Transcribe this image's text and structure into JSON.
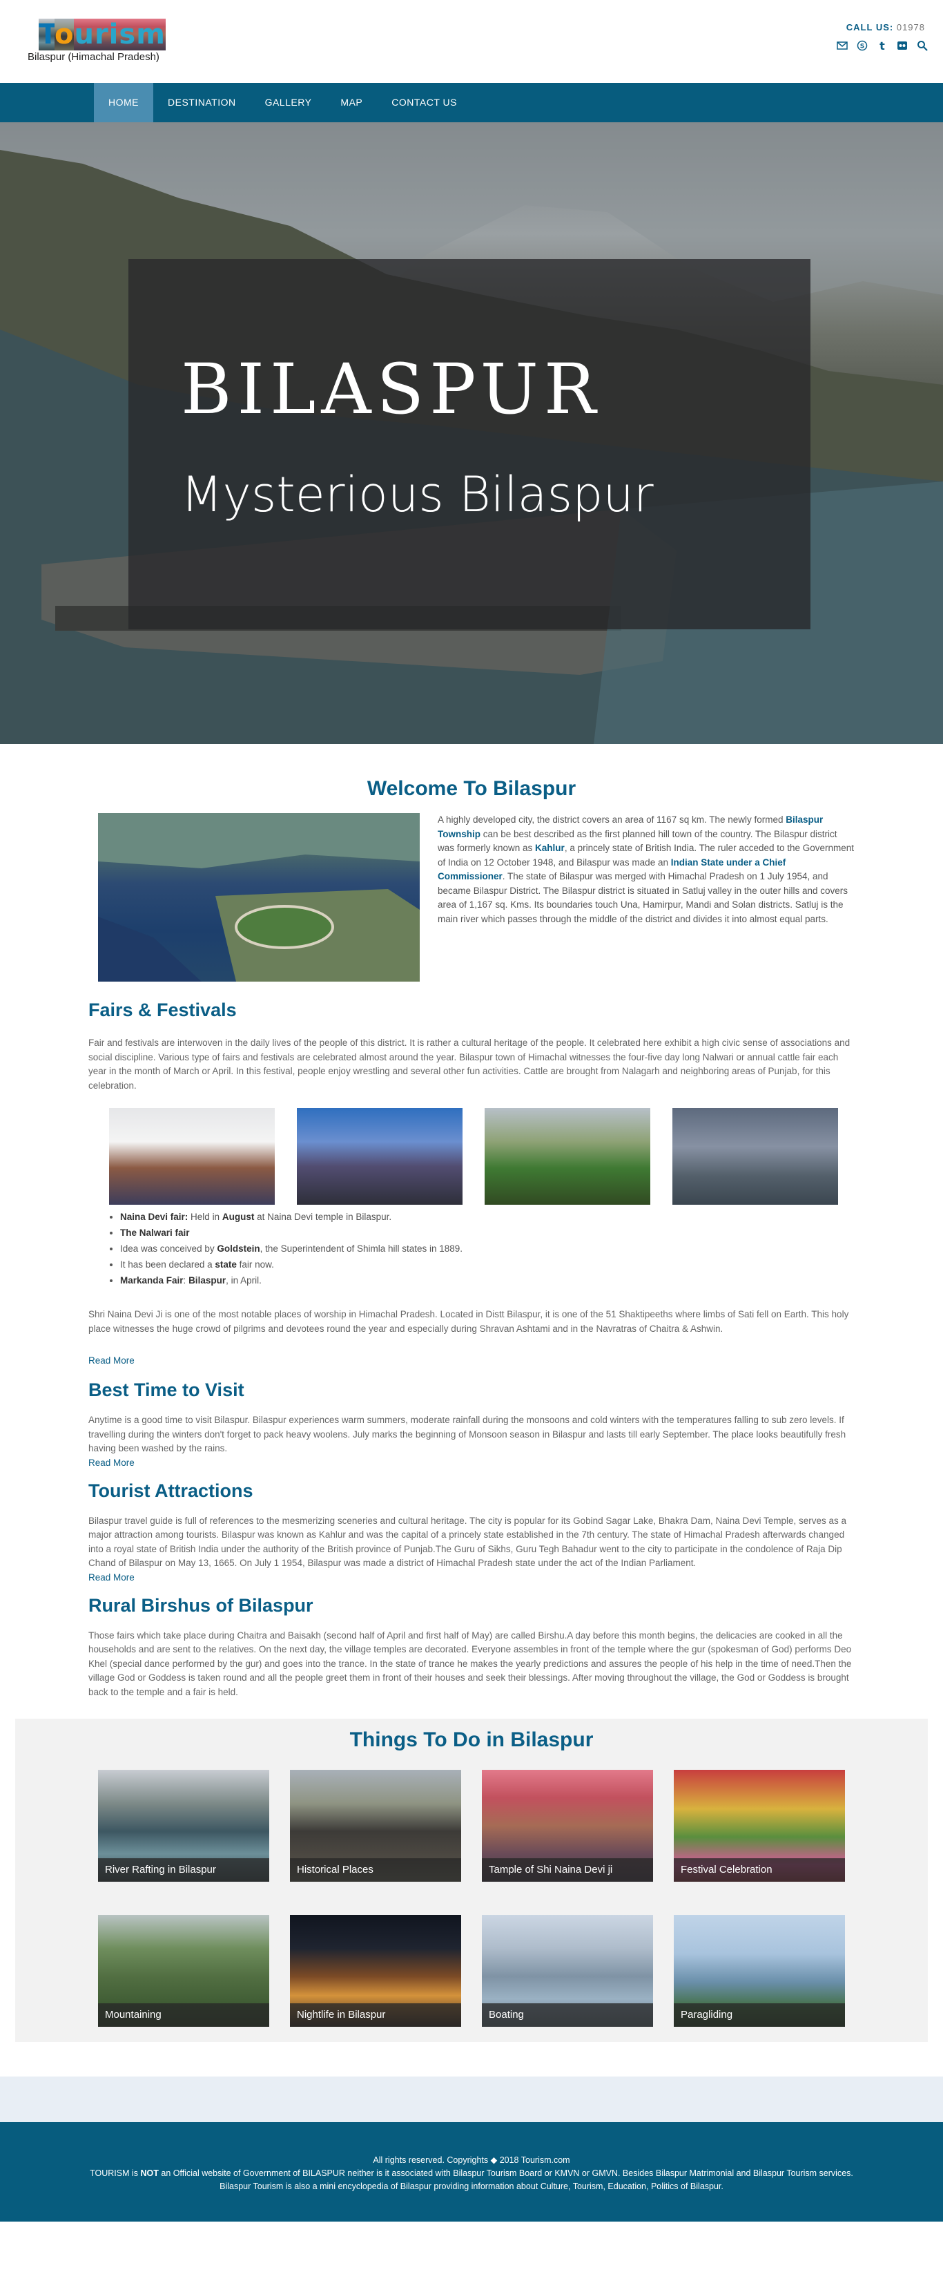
{
  "header": {
    "logo_text": "Tourism",
    "subtitle": "Bilaspur (Himachal Pradesh)",
    "call_label": "CALL US:",
    "call_number": "01978",
    "social_icons": [
      "mail-icon",
      "skype-icon",
      "tumblr-icon",
      "flickr-icon",
      "search-icon"
    ]
  },
  "nav": {
    "items": [
      {
        "label": "HOME",
        "active": true
      },
      {
        "label": "DESTINATION",
        "active": false
      },
      {
        "label": "GALLERY",
        "active": false
      },
      {
        "label": "MAP",
        "active": false
      },
      {
        "label": "CONTACT US",
        "active": false
      }
    ]
  },
  "hero": {
    "title": "BILASPUR",
    "subtitle": "Mysterious Bilaspur"
  },
  "welcome": {
    "heading": "Welcome To Bilaspur",
    "p1": "A highly developed city, the district covers an area of 1167 sq km. The newly formed ",
    "link1": "Bilaspur Township",
    "p2": " can be best described as the first planned hill town of the country. The Bilaspur district was formerly known as ",
    "link2": "Kahlur",
    "p3": ", a princely state of British India. The ruler acceded to the Government of India on 12 October 1948, and Bilaspur was made an ",
    "link3": "Indian State under a Chief Commissioner",
    "p4": ". The state of Bilaspur was merged with Himachal Pradesh on 1 July 1954, and became Bilaspur District. The Bilaspur district is situated in Satluj valley in the outer hills and covers area of 1,167 sq. Kms. Its boundaries touch Una, Hamirpur, Mandi and Solan districts. Satluj is the main river which passes through the middle of the district and divides it into almost equal parts."
  },
  "fairs": {
    "heading": "Fairs & Festivals",
    "intro": "Fair and festivals are interwoven in the daily lives of the people of this district. It is rather a cultural heritage of the people. It celebrated here exhibit a high civic sense of associations and social discipline. Various type of fairs and festivals are celebrated almost around the year. Bilaspur town of Himachal witnesses the four-five day long Nalwari or annual cattle fair each year in the month of March or April. In this festival, people enjoy wrestling and several other fun activities. Cattle are brought from Nalagarh and neighboring areas of Punjab, for this celebration.",
    "list": [
      {
        "bold": "Naina Devi fair:",
        "text": " Held in ",
        "bold2": "August",
        "text2": " at Naina Devi temple in Bilaspur."
      },
      {
        "bold": "The Nalwari fair",
        "text": "",
        "bold2": "",
        "text2": ""
      },
      {
        "bold": "",
        "text": "Idea was conceived by ",
        "bold2": "Goldstein",
        "text2": ", the Superintendent of Shimla hill states in 1889."
      },
      {
        "bold": "",
        "text": "It has been declared a ",
        "bold2": "state",
        "text2": " fair now."
      },
      {
        "bold": "Markanda Fair",
        "text": ": ",
        "bold2": "Bilaspur",
        "text2": ", in April."
      }
    ],
    "naina": "Shri Naina Devi Ji is one of the most notable places of worship in Himachal Pradesh. Located in Distt Bilaspur, it is one of the 51 Shaktipeeths where limbs of Sati fell on Earth. This holy place witnesses the huge crowd of pilgrims and devotees round the year and especially during Shravan Ashtami and in the Navratras of Chaitra & Ashwin.",
    "read_more": "Read More"
  },
  "best_time": {
    "heading": "Best Time to Visit",
    "text": "Anytime is a good time to visit Bilaspur. Bilaspur experiences warm summers, moderate rainfall during the monsoons and cold winters with the temperatures falling to sub zero levels. If travelling during the winters don't forget to pack heavy woolens. July marks the beginning of Monsoon season in Bilaspur and lasts till early September. The place looks beautifully fresh having been washed by the rains.",
    "read_more": "Read More"
  },
  "attractions": {
    "heading": "Tourist Attractions",
    "text": "Bilaspur travel guide is full of references to the mesmerizing sceneries and cultural heritage. The city is popular for its Gobind Sagar Lake, Bhakra Dam, Naina Devi Temple, serves as a major attraction among tourists. Bilaspur was known as Kahlur and was the capital of a princely state established in the 7th century. The state of Himachal Pradesh afterwards changed into a royal state of British India under the authority of the British province of Punjab.The Guru of Sikhs, Guru Tegh Bahadur went to the city to participate in the condolence of Raja Dip Chand of Bilaspur on May 13, 1665. On July 1 1954, Bilaspur was made a district of Himachal Pradesh state under the act of the Indian Parliament.",
    "read_more": "Read More"
  },
  "rural": {
    "heading": "Rural Birshus of Bilaspur",
    "text": "Those fairs which take place during Chaitra and Baisakh (second half of April and first half of May) are called Birshu.A day before this month begins, the delicacies are cooked in all the households and are sent to the relatives. On the next day, the village temples are decorated. Everyone assembles in front of the temple where the gur (spokesman of God) performs Deo Khel (special dance performed by the gur) and goes into the trance. In the state of trance he makes the yearly predictions and assures the people of his help in the time of need.Then the village God or Goddess is taken round and all the people greet them in front of their houses and seek their blessings. After moving throughout the village, the God or Goddess is brought back to the temple and a fair is held."
  },
  "things": {
    "heading": "Things To Do in Bilaspur",
    "items": [
      "River Rafting in Bilaspur",
      "Historical Places",
      "Tample of Shi Naina Devi ji",
      "Festival Celebration",
      "Mountaining",
      "Nightlife in Bilaspur",
      "Boating",
      "Paragliding"
    ]
  },
  "footer": {
    "line1": "All rights reserved. Copyrights ◆ 2018 Tourism.com",
    "line2_a": "TOURISM is ",
    "line2_not": "NOT",
    "line2_b": " an Official website of Government of BILASPUR neither is it associated with Bilaspur Tourism Board or KMVN or GMVN. Besides Bilaspur Matrimonial and Bilaspur Tourism services. Bilaspur Tourism is also a mini encyclopedia of Bilaspur providing information about Culture, Tourism, Education, Politics of Bilaspur."
  }
}
